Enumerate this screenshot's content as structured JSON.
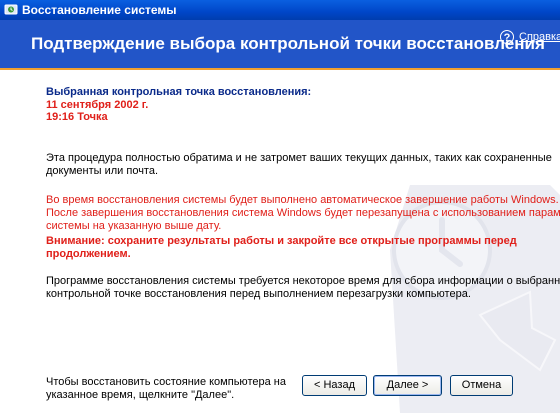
{
  "window": {
    "title": "Восстановление системы"
  },
  "banner": {
    "title": "Подтверждение выбора контрольной точки восстановления",
    "help_link": "Справка"
  },
  "selected": {
    "label": "Выбранная контрольная точка восстановления:",
    "date": "11 сентября 2002 г.",
    "point": "19:16 Точка"
  },
  "text": {
    "para1_line1": "Эта процедура полностью обратима и не затромет ваших текущих данных, таких как сохраненные",
    "para1_line2": "документы или почта.",
    "para2_line1": "Во время восстановления системы будет выполнено автоматическое завершение работы Windows.",
    "para2_line2": "После завершения восстановления система Windows будет перезапущена с использованием параметров",
    "para2_line3": "системы на указанную выше дату.",
    "warn_line1": "Внимание: сохраните результаты работы и закройте все открытые программы перед",
    "warn_line2": "продолжением.",
    "para3_line1": "Программе восстановления системы требуется некоторое время для сбора информации о выбранной",
    "para3_line2": "контрольной точке восстановления перед выполнением перезагрузки компьютера."
  },
  "footer": {
    "hint_line1": "Чтобы восстановить состояние компьютера на",
    "hint_line2": "указанное время, щелкните \"Далее\".",
    "back_label": "< Назад",
    "next_label": "Далее >",
    "cancel_label": "Отмена"
  },
  "colors": {
    "banner": "#2255c8",
    "accent_line": "#f0a030",
    "heading_blue": "#0a2a8a",
    "warning_red": "#e0201a"
  }
}
